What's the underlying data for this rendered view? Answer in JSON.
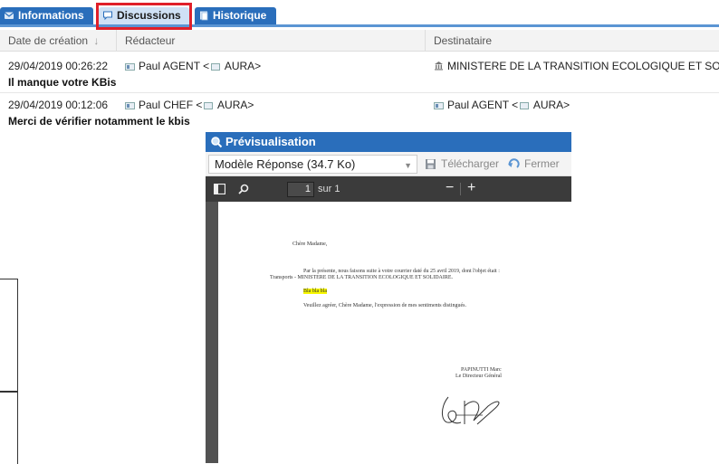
{
  "tabs": [
    {
      "label": "Informations",
      "icon": "envelope-icon"
    },
    {
      "label": "Discussions",
      "icon": "chat-bubble-icon"
    },
    {
      "label": "Historique",
      "icon": "history-icon"
    }
  ],
  "table": {
    "headers": {
      "date": "Date de création",
      "sort": "↓",
      "author": "Rédacteur",
      "recipient": "Destinataire"
    },
    "messages": [
      {
        "date": "29/04/2019 00:26:22",
        "author_pre": "Paul AGENT <",
        "author_post": " AURA>",
        "recipient": "MINISTERE DE LA TRANSITION ECOLOGIQUE ET SO...",
        "subject": "Il manque votre KBis"
      },
      {
        "date": "29/04/2019 00:12:06",
        "author_pre": "Paul CHEF <",
        "author_post": " AURA>",
        "recipient_pre": "Paul AGENT <",
        "recipient_post": " AURA>",
        "subject": "Merci de vérifier notamment le kbis"
      }
    ]
  },
  "preview": {
    "title": "Prévisualisation",
    "file_select": "Modèle Réponse  (34.7 Ko)",
    "download_label": "Télécharger",
    "close_label": "Fermer",
    "pdf": {
      "page_number": "1",
      "page_total": "sur 1",
      "minus": "−",
      "plus": "+"
    },
    "letter": {
      "salutation": "Chère Madame,",
      "line1": "Par la présente, nous faisons suite à votre courrier daté du 25 avril 2019, dont l'objet était :",
      "line2": "Transports - MINISTERE DE LA TRANSITION ECOLOGIQUE ET SOLIDAIRE.",
      "highlight": "Bla bla bla",
      "closing": "Veuillez agréer, Chère Madame, l'expression de mes sentiments distingués.",
      "signer_name": "PAPINUTTI Marc",
      "signer_title": "Le Directeur Général"
    }
  }
}
